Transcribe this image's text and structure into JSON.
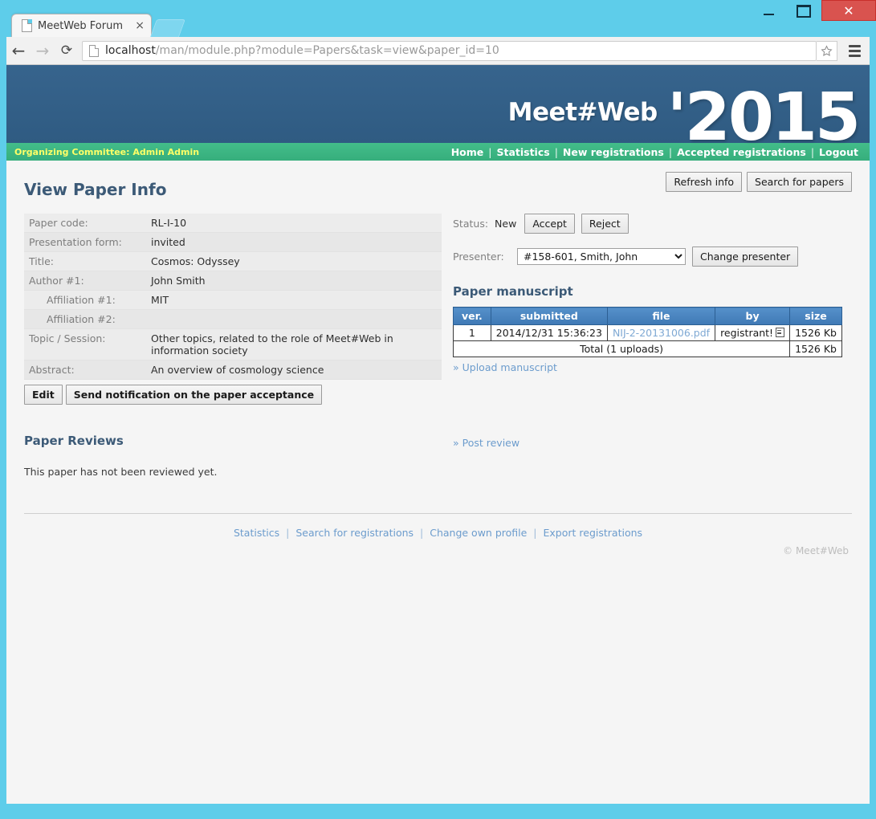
{
  "browser": {
    "tab": {
      "title": "MeetWeb Forum",
      "close_label": "×"
    },
    "newtab_label": "",
    "back_label": "←",
    "forward_label": "→",
    "reload_label": "⟳",
    "url_host": "localhost",
    "url_path": "/man/module.php?module=Papers&task=view&paper_id=10",
    "url_full": "localhost/man/module.php?module=Papers&task=view&paper_id=10",
    "window": {
      "minimize": "—",
      "maximize": "❐",
      "close": "✕"
    }
  },
  "header": {
    "brand_name": "Meet#Web",
    "brand_year": "'2015"
  },
  "nav": {
    "user": "Organizing Committee: Admin Admin",
    "links": [
      "Home",
      "Statistics",
      "New registrations",
      "Accepted registrations",
      "Logout"
    ],
    "separator": "|"
  },
  "page": {
    "title": "View Paper Info",
    "actions": [
      {
        "label": "Refresh info"
      },
      {
        "label": "Search for papers"
      }
    ]
  },
  "info_table": {
    "rows": [
      {
        "label": "Paper code:",
        "value": "RL-I-10",
        "indent": false
      },
      {
        "label": "Presentation form:",
        "value": "invited",
        "indent": false
      },
      {
        "label": "Title:",
        "value": "Cosmos: Odyssey",
        "indent": false
      },
      {
        "label": "Author #1:",
        "value": "John Smith",
        "indent": false
      },
      {
        "label": "Affiliation #1:",
        "value": "MIT",
        "indent": true
      },
      {
        "label": "Affiliation #2:",
        "value": "",
        "indent": true
      },
      {
        "label": "Topic / Session:",
        "value": "Other topics, related to the role of Meet#Web in information society",
        "indent": false
      },
      {
        "label": "Abstract:",
        "value": "An overview of cosmology science",
        "indent": false
      }
    ],
    "buttons": [
      {
        "label": "Edit"
      },
      {
        "label": "Send notification on the paper acceptance"
      }
    ]
  },
  "status": {
    "label": "Status:",
    "value": "New",
    "accept_label": "Accept",
    "reject_label": "Reject"
  },
  "presenter": {
    "label": "Presenter:",
    "selected": "#158-601, Smith, John",
    "options": [
      "#158-601, Smith, John"
    ],
    "change_label": "Change presenter"
  },
  "manuscript": {
    "title": "Paper manuscript",
    "columns": [
      "ver.",
      "submitted",
      "file",
      "by",
      "size"
    ],
    "rows": [
      {
        "ver": "1",
        "submitted": "2014/12/31 15:36:23",
        "file": "NIJ-2-20131006.pdf",
        "by": "registrant!",
        "size": "1526 Kb"
      }
    ],
    "total_label": "Total (1 uploads)",
    "total_size": "1526 Kb",
    "upload_link": "» Upload manuscript"
  },
  "reviews": {
    "title": "Paper Reviews",
    "empty_text": "This paper has not been reviewed yet.",
    "post_link": "» Post review"
  },
  "footer": {
    "links": [
      "Statistics",
      "Search for registrations",
      "Change own profile",
      "Export registrations"
    ],
    "separator": "|",
    "copyright": "© Meet#Web"
  },
  "colors": {
    "chrome_accent": "#5ecdea",
    "header_blue": "#336089",
    "nav_green": "#3cb684",
    "nav_user_yellow": "#ffff66",
    "heading_blue": "#3c5a77",
    "table_header_blue": "#4a84c0",
    "link_blue": "#6c9ccd",
    "close_red": "#d9534f"
  }
}
